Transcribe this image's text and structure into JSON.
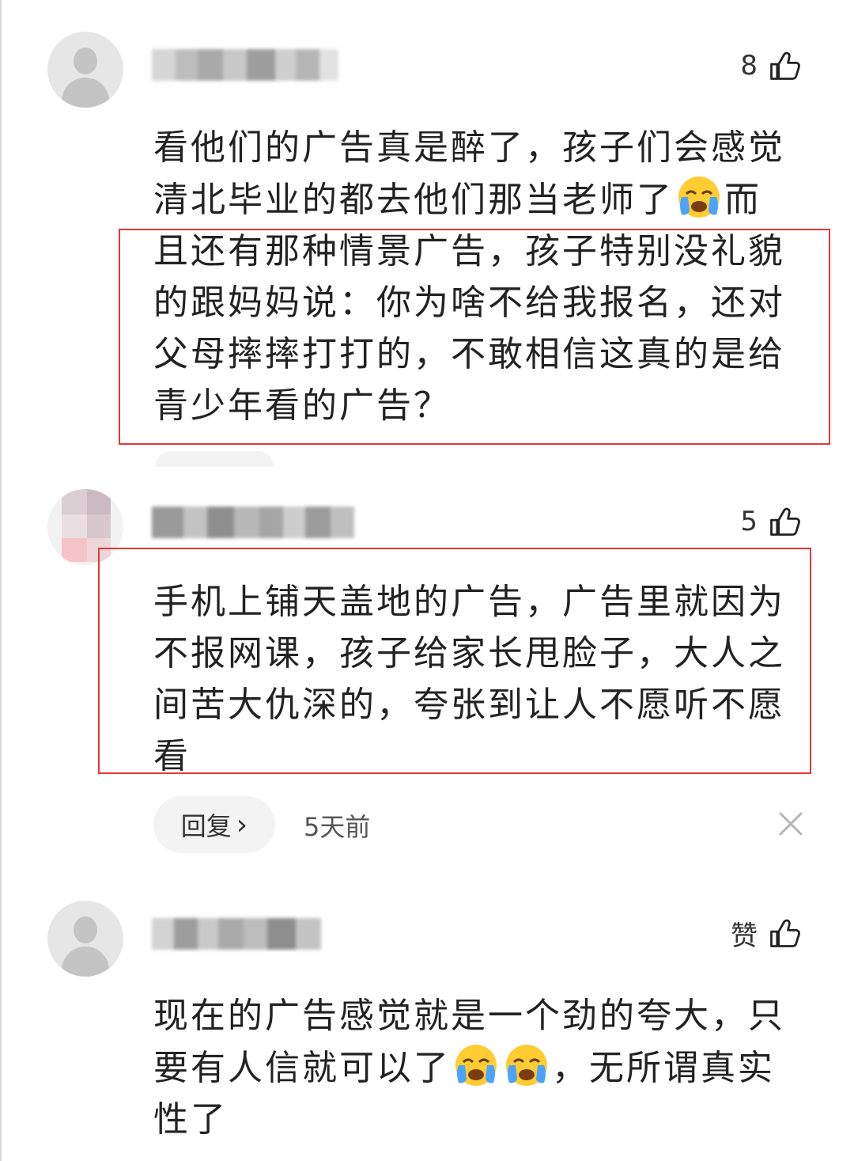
{
  "comments": [
    {
      "likes": "8",
      "lines": [
        [
          "看他们的广告真是醉了，孩子们会感觉"
        ],
        [
          "清北毕业的都去他们那当老师了",
          "而"
        ],
        [
          "且还有那种情景广告，孩子特别没礼貌"
        ],
        [
          "的跟妈妈说：你为啥不给我报名，还对"
        ],
        [
          "父母摔摔打打的，不敢相信这真的是给"
        ],
        [
          "青少年看的广告？"
        ]
      ],
      "emoji": "loudly-crying-face-icon"
    },
    {
      "likes": "5",
      "lines": [
        "手机上铺天盖地的广告，广告里就因为",
        "不报网课，孩子给家长甩脸子，大人之",
        "间苦大仇深的，夸张到让人不愿听不愿",
        "看"
      ],
      "reply_label": "回复",
      "reply_chevron": "›",
      "time": "5天前",
      "close_icon": "close-icon"
    },
    {
      "likes": "赞",
      "lines": [
        [
          "现在的广告感觉就是一个劲的夸大，只"
        ],
        [
          "要有人信就可以了",
          "，无所谓真实"
        ],
        [
          "性了"
        ]
      ]
    }
  ],
  "colors": {
    "highlight_box": "#e53935",
    "text": "#222222",
    "reply_bg": "#f3f3f3"
  }
}
